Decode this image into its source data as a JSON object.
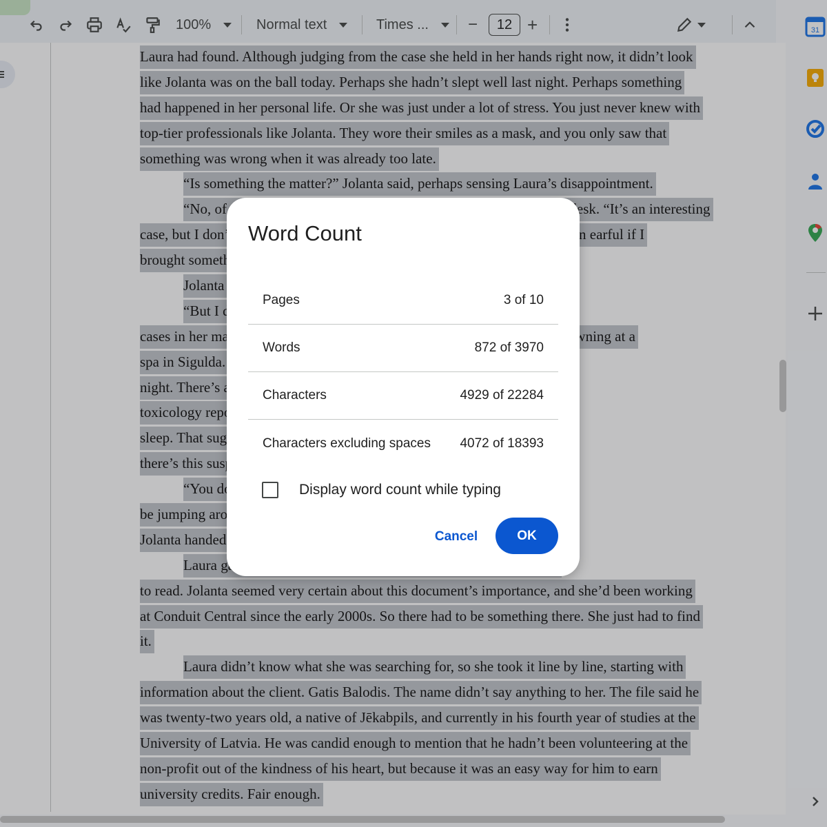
{
  "toolbar": {
    "zoom": "100%",
    "style": "Normal text",
    "font": "Times ...",
    "font_size": "12",
    "minus": "−",
    "plus": "+"
  },
  "document": {
    "lines": [
      {
        "text": "Laura had found. Although judging from the case she held in her hands right now, it didn’t look",
        "indent": false
      },
      {
        "text": "like Jolanta was on the ball today. Perhaps she hadn’t slept well last night. Perhaps something",
        "indent": false
      },
      {
        "text": "had happened in her personal life. Or she was just under a lot of stress. You just never knew with",
        "indent": false
      },
      {
        "text": "top-tier professionals like Jolanta. They wore their smiles as a mask, and you only saw that",
        "indent": false
      },
      {
        "text": "something was wrong when it was already too late.",
        "indent": false
      },
      {
        "text": "“Is something the matter?” Jolanta said, perhaps sensing Laura’s disappointment.",
        "indent": true
      },
      {
        "text": "“No, of course not,” Laura said, putting the case back on Jolanta’s desk. “It’s an interesting",
        "indent": true
      },
      {
        "text": "case, but I don’t think it’s what we are looking for. Katrina would give me an earful if I",
        "indent": false
      },
      {
        "text": "brought something like this to her.”",
        "indent": false
      },
      {
        "text": "Jolanta nodded.",
        "indent": true
      },
      {
        "text": "“But I do have something else,” she said, and picked up the three",
        "indent": true
      },
      {
        "text": "cases in her margin. “It’s only the third one that stands out. There’s this drowning at a",
        "indent": false
      },
      {
        "text": "spa in Sigulda. He was found in the pool after it had been closed for the",
        "indent": false
      },
      {
        "text": "night. There’s a lot pointing towards this being an accident, but the",
        "indent": false
      },
      {
        "text": "toxicology report found enough of a sedative to put a horse to",
        "indent": false
      },
      {
        "text": "sleep. That suggests... And last, but not least, definitely least,",
        "indent": false
      },
      {
        "text": "there’s this suspect...",
        "indent": false
      },
      {
        "text": "“You don’t seem convinced,” Jolanta said dryly. “If you did, you’d",
        "indent": true
      },
      {
        "text": "be jumping around the office so much you couldn’t get a breath in.”",
        "indent": false
      },
      {
        "text": "Jolanta handed the case back. “Read it again. Closely this time.”",
        "indent": false
      },
      {
        "text": "Laura gave her a skeptical look, but she took the case, and began",
        "indent": true
      },
      {
        "text": "to read. Jolanta seemed very certain about this document’s importance, and she’d been working",
        "indent": false
      },
      {
        "text": "at Conduit Central since the early 2000s. So there had to be something there. She just had to find",
        "indent": false
      },
      {
        "text": "it.",
        "indent": false
      },
      {
        "text": "Laura didn’t know what she was searching for, so she took it line by line, starting with",
        "indent": true
      },
      {
        "text": "information about the client. Gatis Balodis. The name didn’t say anything to her. The file said he",
        "indent": false
      },
      {
        "text": "was twenty-two years old, a native of Jēkabpils, and currently in his fourth year of studies at the",
        "indent": false
      },
      {
        "text": "University of Latvia. He was candid enough to mention that he hadn’t been volunteering at the",
        "indent": false
      },
      {
        "text": "non-profit out of the kindness of his heart, but because it was an easy way for him to earn",
        "indent": false
      },
      {
        "text": "university credits. Fair enough.",
        "indent": false
      }
    ]
  },
  "dialog": {
    "title": "Word Count",
    "rows": [
      {
        "label": "Pages",
        "value": "3 of 10"
      },
      {
        "label": "Words",
        "value": "872 of 3970"
      },
      {
        "label": "Characters",
        "value": "4929 of 22284"
      },
      {
        "label": "Characters excluding spaces",
        "value": "4072 of 18393"
      }
    ],
    "checkbox_label": "Display word count while typing",
    "checkbox_checked": false,
    "cancel_label": "Cancel",
    "ok_label": "OK"
  },
  "side_panel": {
    "calendar_day": "31",
    "icons": [
      "calendar-icon",
      "keep-icon",
      "tasks-icon",
      "contacts-icon",
      "maps-icon",
      "add-icon",
      "expand-icon"
    ]
  },
  "colors": {
    "accent": "#0b57d0",
    "selection": "#c3c6cc",
    "toolbar_bg": "#f0f4f9"
  }
}
